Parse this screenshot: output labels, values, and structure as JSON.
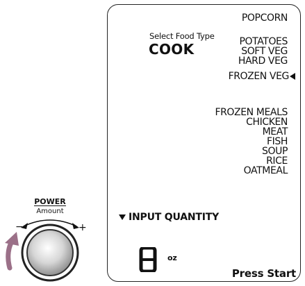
{
  "knob": {
    "power_label": "POWER",
    "amount_label": "Amount",
    "minus": "−",
    "plus": "+"
  },
  "display": {
    "select_food_type": "Select Food Type",
    "mode": "COOK",
    "food_types_top": [
      "POPCORN",
      "POTATOES",
      "SOFT VEG",
      "HARD VEG",
      "FROZEN VEG"
    ],
    "selected_index_top": 4,
    "food_types_bottom": [
      "FROZEN MEALS",
      "CHICKEN",
      "MEAT",
      "FISH",
      "SOUP",
      "RICE",
      "OATMEAL"
    ],
    "input_quantity": "INPUT QUANTITY",
    "quantity_value": "8",
    "quantity_unit": "oz",
    "press_start": "Press Start"
  },
  "colors": {
    "rotation_arrow": "#9b7088",
    "knob_ring": "#222222"
  }
}
